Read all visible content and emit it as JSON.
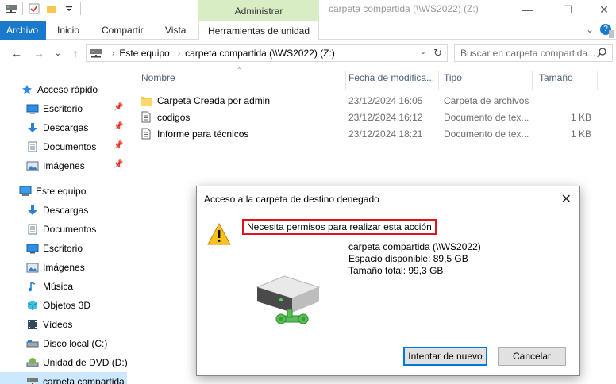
{
  "titlebar": {
    "context_tab": "Administrar",
    "window_title": "carpeta compartida (\\\\WS2022) (Z:)",
    "minimize": "—",
    "maximize": "☐",
    "close": "✕"
  },
  "ribbon": {
    "file": "Archivo",
    "tabs": [
      "Inicio",
      "Compartir",
      "Vista"
    ],
    "tools": "Herramientas de unidad",
    "expand": "⌄",
    "help": "?"
  },
  "nav": {
    "back": "←",
    "forward": "→",
    "recent": "⌄",
    "up": "↑",
    "crumbs": [
      "Este equipo",
      "carpeta compartida (\\\\WS2022) (Z:)"
    ],
    "dropdown": "⌄",
    "refresh": "↻",
    "search_placeholder": "Buscar en carpeta compartida..."
  },
  "sidebar": {
    "items": [
      {
        "label": "Acceso rápido",
        "icon": "star-icon"
      },
      {
        "label": "Escritorio",
        "icon": "desktop-icon",
        "pinned": true
      },
      {
        "label": "Descargas",
        "icon": "download-icon",
        "pinned": true
      },
      {
        "label": "Documentos",
        "icon": "documents-icon",
        "pinned": true
      },
      {
        "label": "Imágenes",
        "icon": "pictures-icon",
        "pinned": true
      },
      {
        "label": "Este equipo",
        "icon": "computer-icon"
      },
      {
        "label": "Descargas",
        "icon": "download-icon"
      },
      {
        "label": "Documentos",
        "icon": "documents-icon"
      },
      {
        "label": "Escritorio",
        "icon": "desktop-icon"
      },
      {
        "label": "Imágenes",
        "icon": "pictures-icon"
      },
      {
        "label": "Música",
        "icon": "music-icon"
      },
      {
        "label": "Objetos 3D",
        "icon": "cube-icon"
      },
      {
        "label": "Vídeos",
        "icon": "video-icon"
      },
      {
        "label": "Disco local (C:)",
        "icon": "disk-icon"
      },
      {
        "label": "Unidad de DVD (D:)",
        "icon": "dvd-icon"
      },
      {
        "label": "carpeta compartida",
        "icon": "network-drive-icon"
      }
    ]
  },
  "filelist": {
    "columns": [
      "Nombre",
      "Fecha de modifica...",
      "Tipo",
      "Tamaño"
    ],
    "rows": [
      {
        "name": "Carpeta Creada por admin",
        "date": "23/12/2024 16:05",
        "type": "Carpeta de archivos",
        "size": "",
        "icon": "folder-icon"
      },
      {
        "name": "codigos",
        "date": "23/12/2024 16:12",
        "type": "Documento de tex...",
        "size": "1 KB",
        "icon": "text-file-icon"
      },
      {
        "name": "Informe para técnicos",
        "date": "23/12/2024 18:21",
        "type": "Documento de tex...",
        "size": "1 KB",
        "icon": "text-file-icon"
      }
    ]
  },
  "dialog": {
    "title": "Acceso a la carpeta de destino denegado",
    "close": "✕",
    "message": "Necesita permisos para realizar esta acción",
    "info": [
      "carpeta compartida (\\\\WS2022)",
      "Espacio disponible: 89,5 GB",
      "Tamaño total: 99,3 GB"
    ],
    "retry": "Intentar de nuevo",
    "cancel": "Cancelar"
  },
  "colors": {
    "accent": "#1979ca",
    "manage_tab": "#d9edc4",
    "selection": "#cce8ff",
    "highlight_box": "#e0131c"
  }
}
